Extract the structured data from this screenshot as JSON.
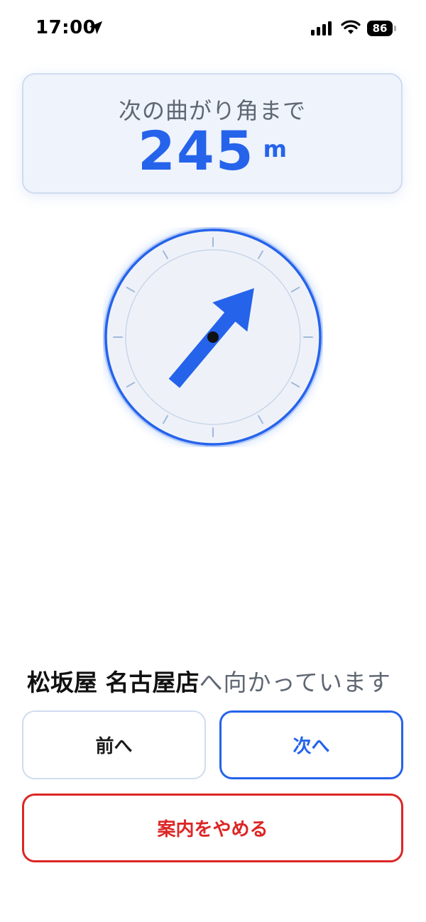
{
  "status_bar": {
    "time": "17:00",
    "battery": "86",
    "icons": [
      "location-arrow-icon",
      "cellular-signal-icon",
      "wifi-icon",
      "battery-icon"
    ]
  },
  "distance_card": {
    "label": "次の曲がり角まで",
    "value": "245",
    "unit": "m"
  },
  "compass": {
    "arrow_heading_degrees": 40,
    "colors": {
      "accent": "#2563eb",
      "face": "#eef2f8",
      "tick": "#9fb8dc",
      "center_dot": "#111111"
    }
  },
  "destination": {
    "name": "松坂屋 名古屋店",
    "suffix": "へ向かっています"
  },
  "buttons": {
    "prev_label": "前へ",
    "next_label": "次へ",
    "stop_label": "案内をやめる"
  },
  "colors": {
    "accent": "#2563eb",
    "danger": "#dc2626",
    "muted_text": "#5f6773",
    "card_border": "#cfdcf0",
    "card_bg": "#eef3fc"
  }
}
